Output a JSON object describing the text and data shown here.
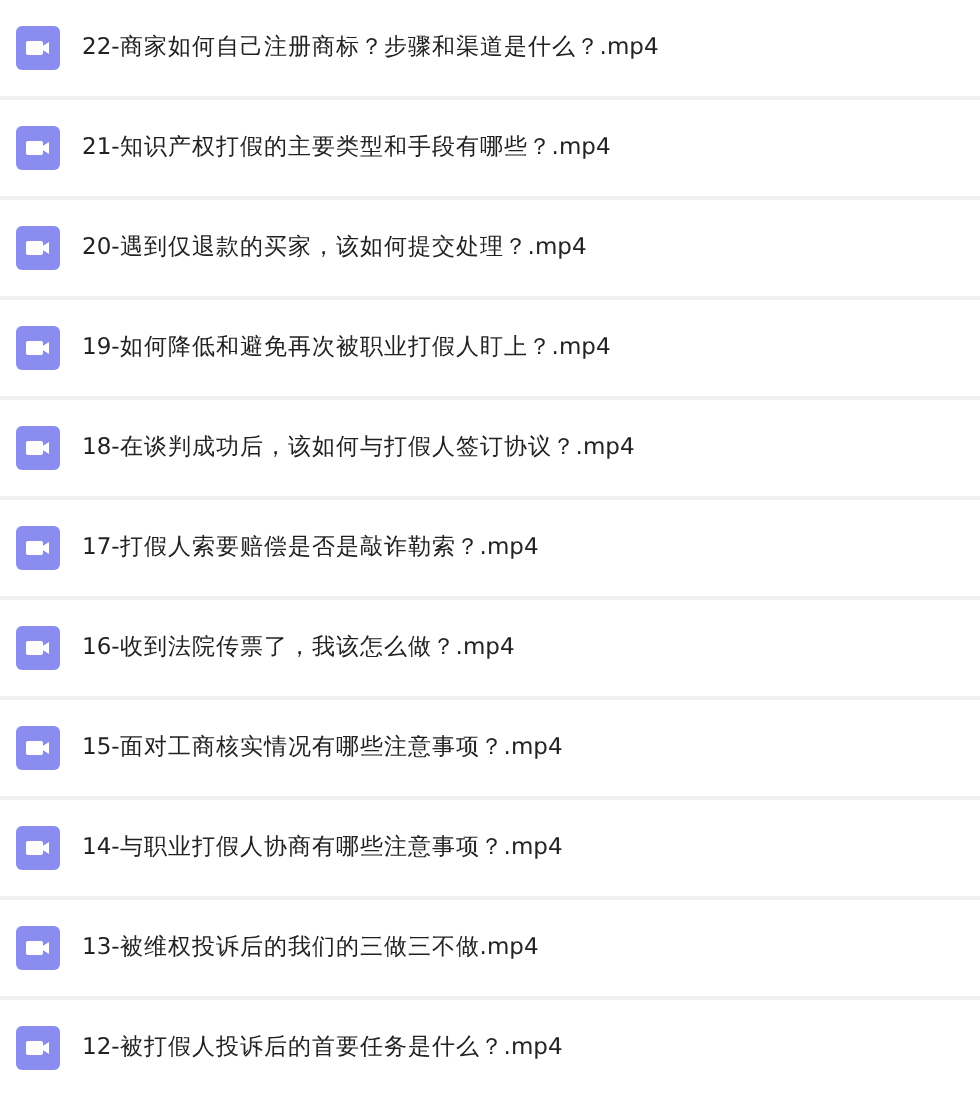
{
  "files": [
    {
      "name": "22-商家如何自己注册商标？步骤和渠道是什么？.mp4"
    },
    {
      "name": "21-知识产权打假的主要类型和手段有哪些？.mp4"
    },
    {
      "name": "20-遇到仅退款的买家，该如何提交处理？.mp4"
    },
    {
      "name": "19-如何降低和避免再次被职业打假人盯上？.mp4"
    },
    {
      "name": "18-在谈判成功后，该如何与打假人签订协议？.mp4"
    },
    {
      "name": "17-打假人索要赔偿是否是敲诈勒索？.mp4"
    },
    {
      "name": "16-收到法院传票了，我该怎么做？.mp4"
    },
    {
      "name": "15-面对工商核实情况有哪些注意事项？.mp4"
    },
    {
      "name": "14-与职业打假人协商有哪些注意事项？.mp4"
    },
    {
      "name": "13-被维权投诉后的我们的三做三不做.mp4"
    },
    {
      "name": "12-被打假人投诉后的首要任务是什么？.mp4"
    }
  ]
}
